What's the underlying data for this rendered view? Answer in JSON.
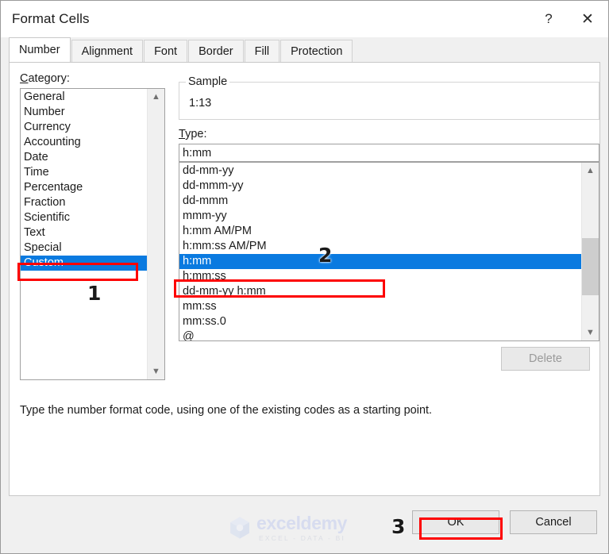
{
  "window": {
    "title": "Format Cells",
    "help_icon": "question-mark-icon",
    "close_icon": "close-icon"
  },
  "tabs": [
    {
      "label": "Number",
      "active": true
    },
    {
      "label": "Alignment",
      "active": false
    },
    {
      "label": "Font",
      "active": false
    },
    {
      "label": "Border",
      "active": false
    },
    {
      "label": "Fill",
      "active": false
    },
    {
      "label": "Protection",
      "active": false
    }
  ],
  "category": {
    "label": "Category:",
    "label_accel": "C",
    "items": [
      "General",
      "Number",
      "Currency",
      "Accounting",
      "Date",
      "Time",
      "Percentage",
      "Fraction",
      "Scientific",
      "Text",
      "Special",
      "Custom"
    ],
    "selected": "Custom"
  },
  "sample": {
    "label": "Sample",
    "value": "1:13"
  },
  "type": {
    "label": "Type:",
    "label_accel": "T",
    "input_value": "h:mm",
    "items": [
      "dd-mm-yy",
      "dd-mmm-yy",
      "dd-mmm",
      "mmm-yy",
      "h:mm AM/PM",
      "h:mm:ss AM/PM",
      "h:mm",
      "h:mm:ss",
      "dd-mm-yy h:mm",
      "mm:ss",
      "mm:ss.0",
      "@"
    ],
    "selected": "h:mm"
  },
  "delete_button": {
    "label": "Delete",
    "enabled": false
  },
  "hint": "Type the number format code, using one of the existing codes as a starting point.",
  "footer": {
    "ok_label": "OK",
    "cancel_label": "Cancel"
  },
  "watermark": {
    "name": "exceldemy",
    "tagline": "EXCEL - DATA - BI"
  },
  "annotations": [
    {
      "number": "1",
      "target": "category-custom-item"
    },
    {
      "number": "2",
      "target": "type-hmm-item"
    },
    {
      "number": "3",
      "target": "ok-button"
    }
  ],
  "colors": {
    "selection_blue": "#0a7ae0",
    "annotation_red": "#fd0000",
    "dialog_background": "#f0f0f0"
  }
}
